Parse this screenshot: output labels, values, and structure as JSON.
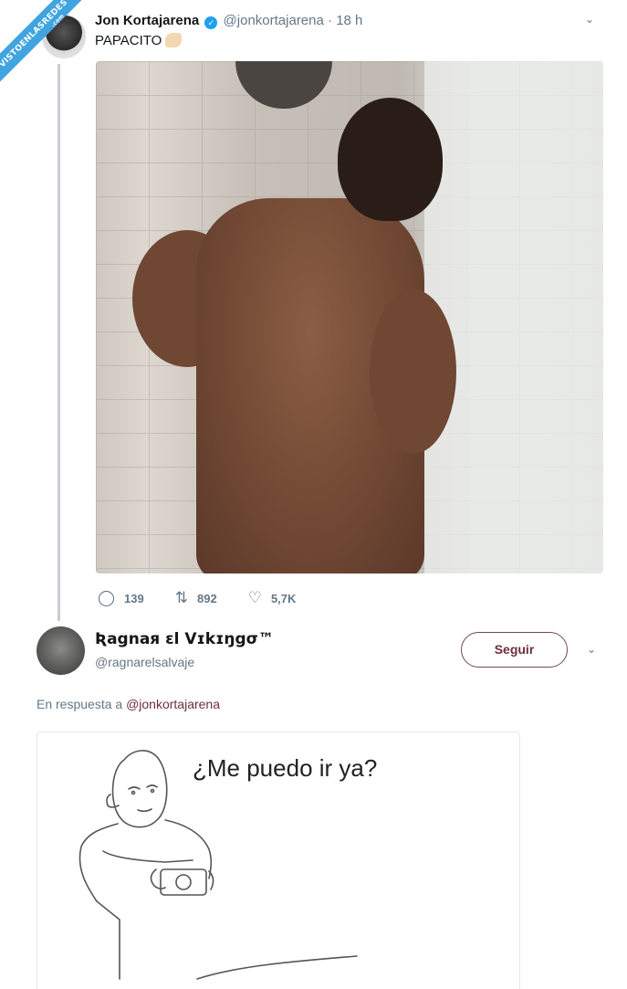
{
  "watermark": {
    "text": "VISTOENLASREDES",
    "sub": ".com"
  },
  "tweet1": {
    "author_name": "Jon Kortajarena",
    "verified_mark": "✓",
    "handle": "@jonkortajarena",
    "separator": " · ",
    "time": "18 h",
    "text": "PAPACITO",
    "emoji_icon": "flexed-biceps-icon",
    "replies": "139",
    "retweets": "892",
    "likes": "5,7K"
  },
  "tweet2": {
    "author_name": "Ʀagnaя ɛl Vɪkɪŋgσ™",
    "handle": "@ragnarelsalvaje",
    "follow_label": "Seguir",
    "reply_prefix": "En respuesta a",
    "reply_handle": "@jonkortajarena",
    "meme_text": "¿Me puedo ir ya?"
  },
  "colors": {
    "accent": "#6e2f3b",
    "verified": "#1da1f2",
    "muted": "#657786"
  }
}
